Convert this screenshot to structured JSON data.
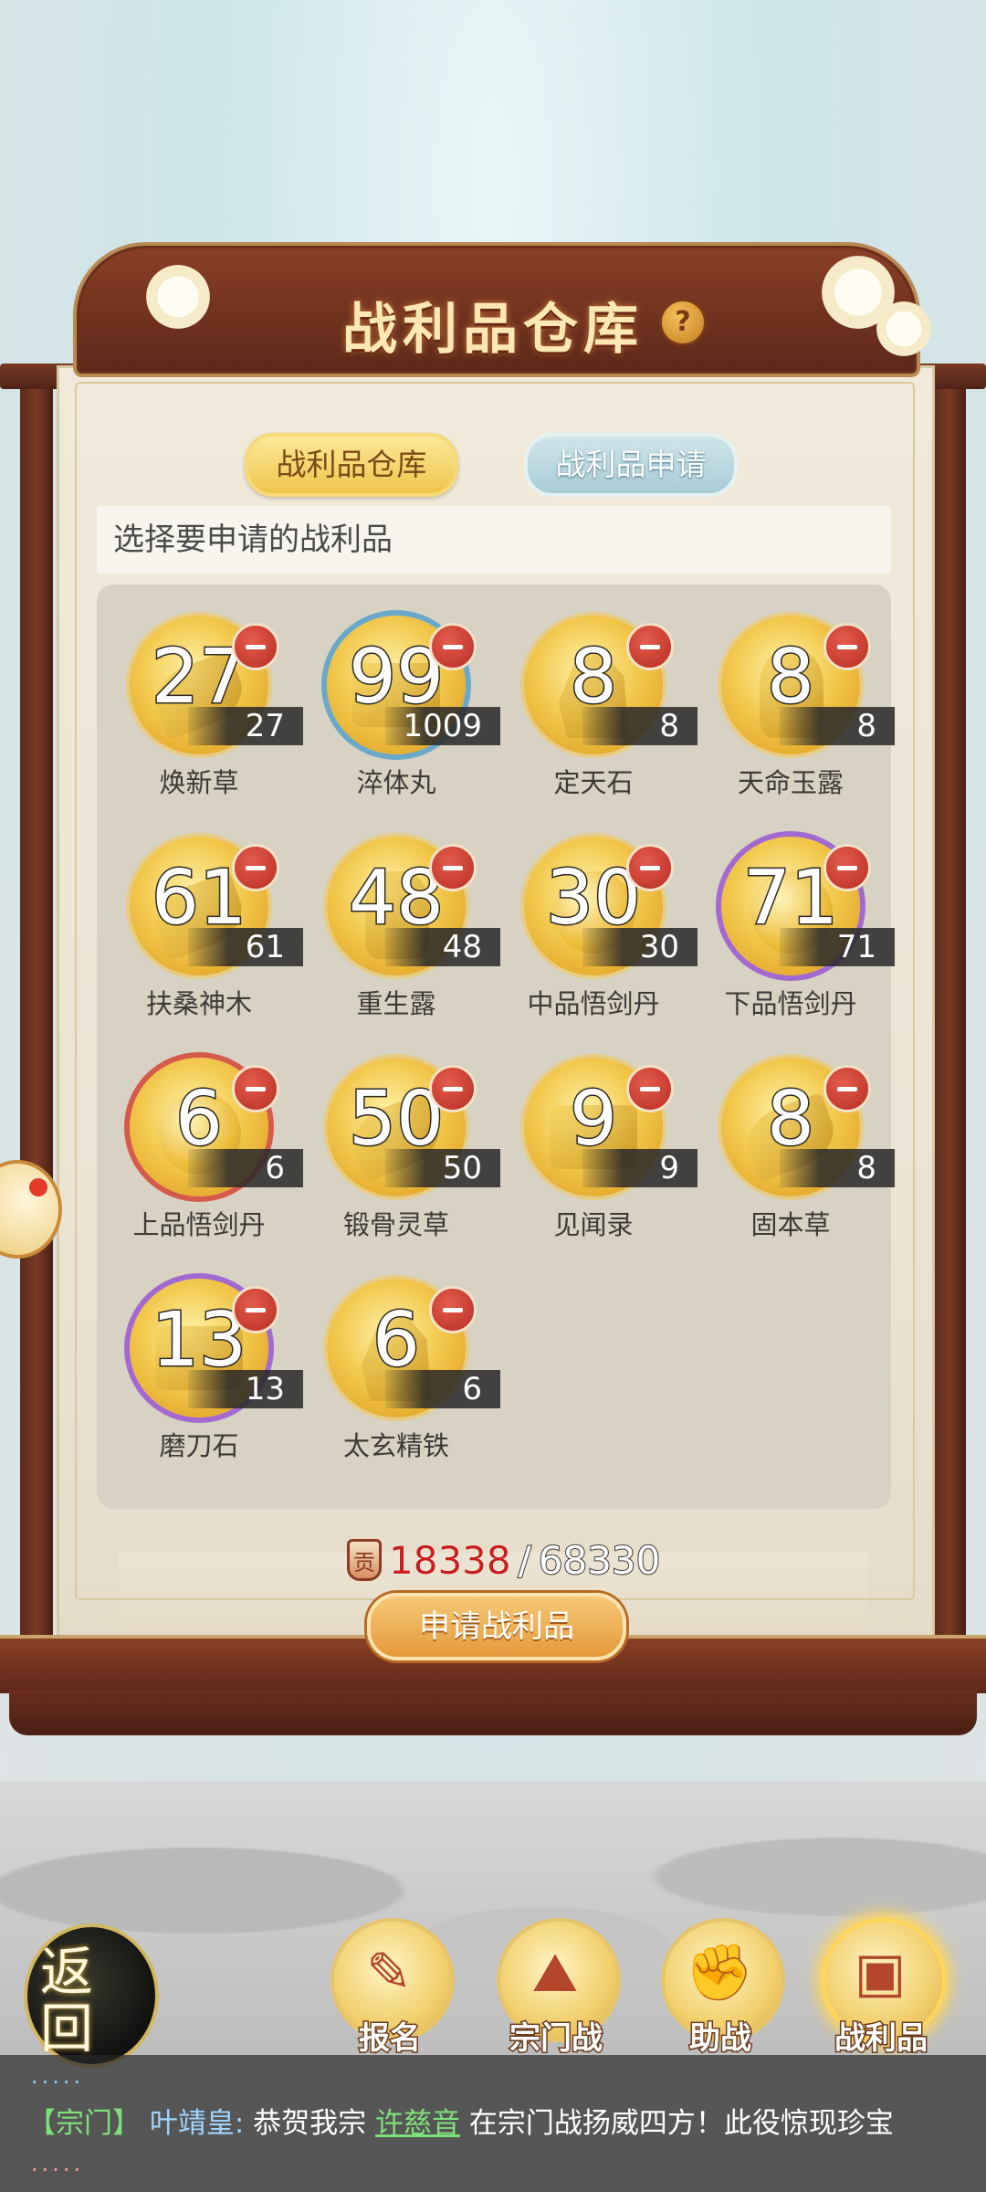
{
  "header": {
    "title": "战利品仓库",
    "help_glyph": "?"
  },
  "tabs": [
    {
      "label": "战利品仓库",
      "active": true
    },
    {
      "label": "战利品申请",
      "active": false
    }
  ],
  "prompt": "选择要申请的战利品",
  "items": [
    {
      "name": "焕新草",
      "selected": "27",
      "owned": "27",
      "icon": "grass-icon"
    },
    {
      "name": "淬体丸",
      "selected": "99",
      "owned": "1009",
      "icon": "pill-box-icon"
    },
    {
      "name": "定天石",
      "selected": "8",
      "owned": "8",
      "icon": "stone-icon"
    },
    {
      "name": "天命玉露",
      "selected": "8",
      "owned": "8",
      "icon": "jade-vase-icon"
    },
    {
      "name": "扶桑神木",
      "selected": "61",
      "owned": "61",
      "icon": "branch-icon"
    },
    {
      "name": "重生露",
      "selected": "48",
      "owned": "48",
      "icon": "bottle-icon"
    },
    {
      "name": "中品悟剑丹",
      "selected": "30",
      "owned": "30",
      "icon": "orb-box-icon"
    },
    {
      "name": "下品悟剑丹",
      "selected": "71",
      "owned": "71",
      "icon": "orb-box-icon"
    },
    {
      "name": "上品悟剑丹",
      "selected": "6",
      "owned": "6",
      "icon": "orb-box-icon"
    },
    {
      "name": "锻骨灵草",
      "selected": "50",
      "owned": "50",
      "icon": "flower-icon"
    },
    {
      "name": "见闻录",
      "selected": "9",
      "owned": "9",
      "icon": "book-icon"
    },
    {
      "name": "固本草",
      "selected": "8",
      "owned": "8",
      "icon": "herb-icon"
    },
    {
      "name": "磨刀石",
      "selected": "13",
      "owned": "13",
      "icon": "whetstone-icon"
    },
    {
      "name": "太玄精铁",
      "selected": "6",
      "owned": "6",
      "icon": "iron-ore-icon"
    }
  ],
  "points": {
    "icon_glyph": "贡",
    "current": "18338",
    "separator": "/",
    "total": "68330"
  },
  "apply_button": "申请战利品",
  "nav": {
    "back_label": "返回",
    "items": [
      {
        "label": "报名",
        "glyph": "✎",
        "active": false
      },
      {
        "label": "宗门战",
        "glyph": "⛰",
        "active": false
      },
      {
        "label": "助战",
        "glyph": "✊",
        "active": false
      },
      {
        "label": "战利品",
        "glyph": "▣",
        "active": true
      }
    ]
  },
  "chat": {
    "channel": "【宗门】",
    "user": "叶靖皇:",
    "text_before": "恭贺我宗",
    "highlight": "许慈音",
    "text_after": "在宗门战扬威四方！此役惊现珍宝"
  },
  "colors": {
    "accent_gold": "#f0c54a",
    "badge_red": "#c8201f",
    "frame_wood": "#7a3a26"
  }
}
